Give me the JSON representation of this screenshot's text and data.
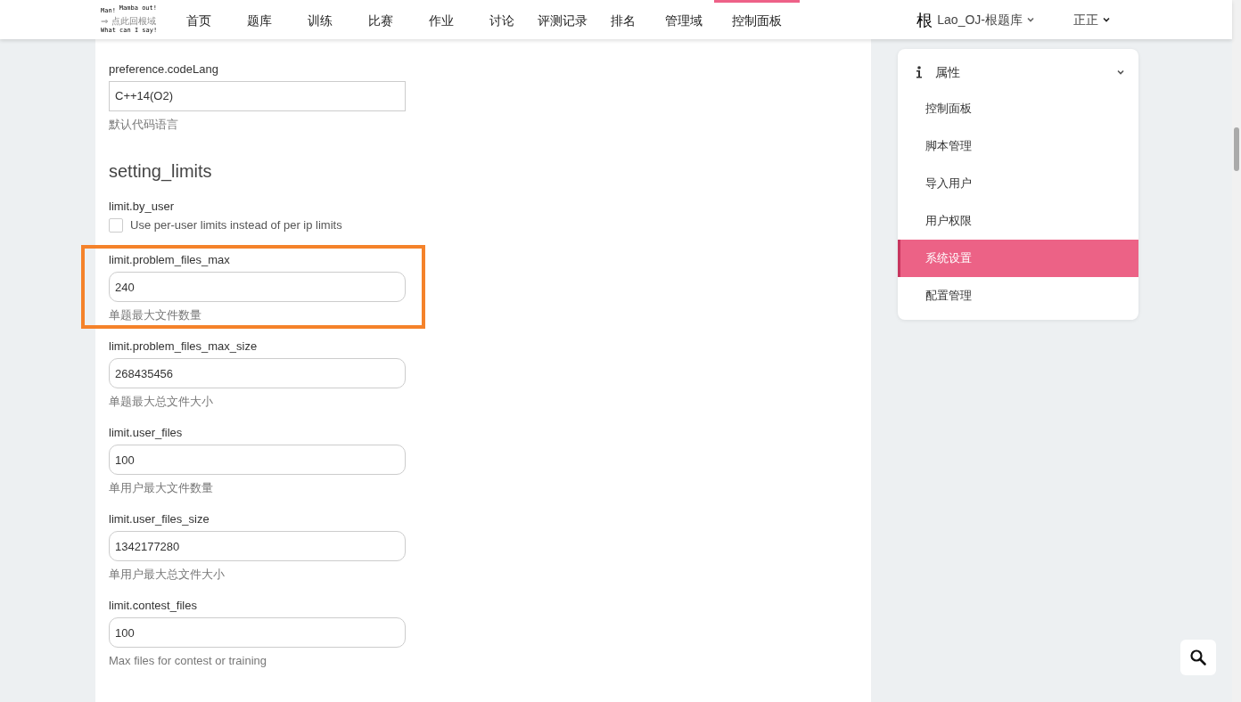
{
  "navbar": {
    "logo_lines": [
      [
        "Man!",
        "Mamba out!"
      ],
      [
        "⇒ 点此回根域"
      ],
      [
        "What can I say!"
      ]
    ],
    "items": [
      {
        "label": "首页",
        "selected": false
      },
      {
        "label": "题库",
        "selected": false
      },
      {
        "label": "训练",
        "selected": false
      },
      {
        "label": "比赛",
        "selected": false
      },
      {
        "label": "作业",
        "selected": false
      },
      {
        "label": "讨论",
        "selected": false
      },
      {
        "label": "评测记录",
        "selected": false
      },
      {
        "label": "排名",
        "selected": false
      },
      {
        "label": "管理域",
        "selected": false
      },
      {
        "label": "控制面板",
        "selected": true
      }
    ],
    "domain": {
      "glyph": "根",
      "label": "Lao_OJ-根题库"
    },
    "user": "正正"
  },
  "settings": [
    {
      "kind": "select",
      "label": "preference.codeLang",
      "value": "C++14(O2)",
      "hint": "默认代码语言"
    },
    {
      "kind": "heading",
      "label": "setting_limits"
    },
    {
      "kind": "checkbox",
      "label": "limit.by_user",
      "text": "Use per-user limits instead of per ip limits",
      "checked": false
    },
    {
      "kind": "input",
      "label": "limit.problem_files_max",
      "value": "240",
      "hint": "单题最大文件数量",
      "highlighted": true
    },
    {
      "kind": "input",
      "label": "limit.problem_files_max_size",
      "value": "268435456",
      "hint": "单题最大总文件大小",
      "highlighted": false
    },
    {
      "kind": "input",
      "label": "limit.user_files",
      "value": "100",
      "hint": "单用户最大文件数量",
      "highlighted": false
    },
    {
      "kind": "input",
      "label": "limit.user_files_size",
      "value": "1342177280",
      "hint": "单用户最大总文件大小",
      "highlighted": false
    },
    {
      "kind": "input",
      "label": "limit.contest_files",
      "value": "100",
      "hint": "Max files for contest or training",
      "highlighted": false
    }
  ],
  "sidebar": {
    "title": "属性",
    "expanded": true,
    "items": [
      {
        "label": "控制面板",
        "selected": false
      },
      {
        "label": "脚本管理",
        "selected": false
      },
      {
        "label": "导入用户",
        "selected": false
      },
      {
        "label": "用户权限",
        "selected": false
      },
      {
        "label": "系统设置",
        "selected": true
      },
      {
        "label": "配置管理",
        "selected": false
      }
    ]
  }
}
